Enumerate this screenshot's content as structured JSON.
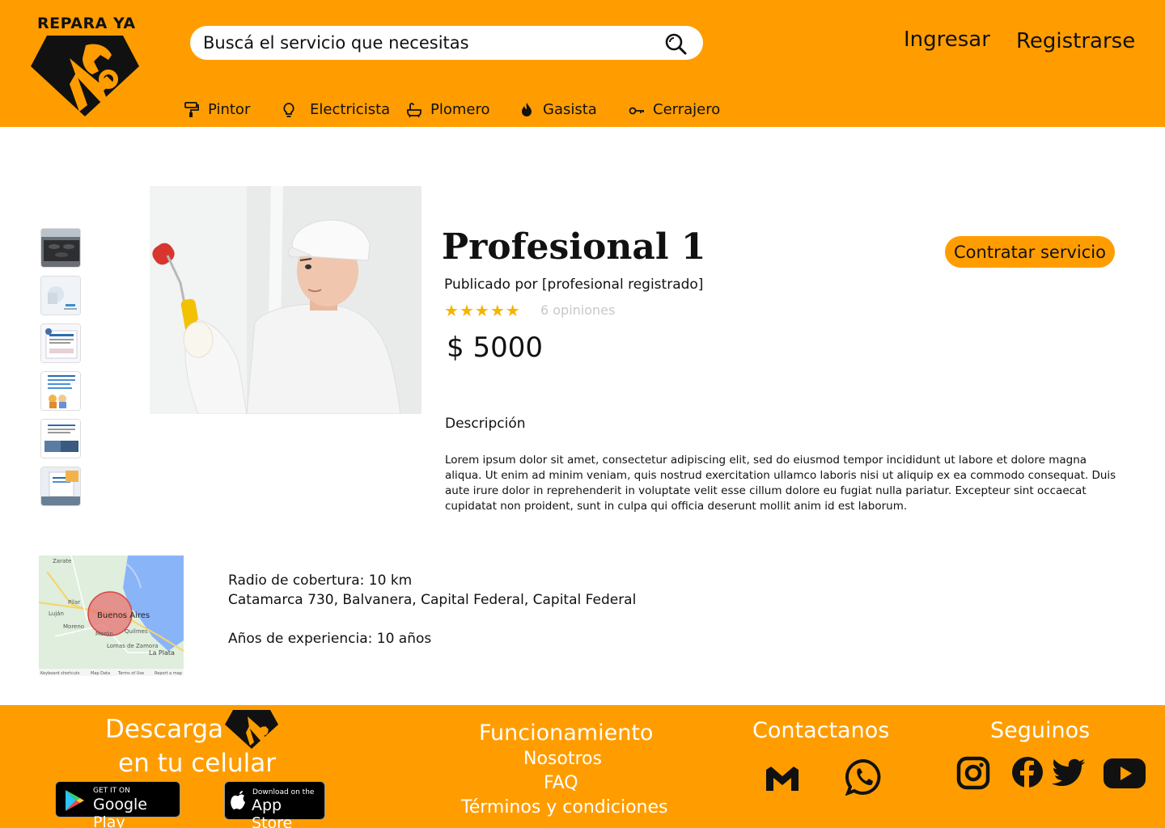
{
  "brand": {
    "name": "REPARA YA"
  },
  "header": {
    "search_placeholder": "Buscá el servicio que necesitas",
    "login": "Ingresar",
    "register": "Registrarse"
  },
  "nav": {
    "items": [
      {
        "label": "Pintor",
        "icon": "paint-roller-icon"
      },
      {
        "label": "Electricista",
        "icon": "lightbulb-icon"
      },
      {
        "label": "Plomero",
        "icon": "bathtub-icon"
      },
      {
        "label": "Gasista",
        "icon": "flame-icon"
      },
      {
        "label": "Cerrajero",
        "icon": "key-icon"
      }
    ]
  },
  "product": {
    "title": "Profesional 1",
    "published_by": "Publicado por [profesional registrado]",
    "rating": 5,
    "reviews": "6 opiniones",
    "price": "$ 5000",
    "hire_button": "Contratar servicio",
    "description_title": "Descripción",
    "description": "Lorem ipsum dolor sit amet, consectetur adipiscing elit, sed do eiusmod tempor incididunt ut labore et dolore magna aliqua. Ut enim ad minim veniam, quis nostrud exercitation ullamco laboris nisi ut aliquip ex ea commodo consequat. Duis aute irure dolor in reprehenderit in voluptate velit esse cillum dolore eu fugiat nulla pariatur. Excepteur sint occaecat cupidatat non proident, sunt in culpa qui officia deserunt mollit anim id est laborum."
  },
  "map": {
    "labels": [
      "Zarate",
      "Pilar",
      "Luján",
      "Moreno",
      "Morón",
      "Buenos Aires",
      "Quilmes",
      "Lomas de Zamora",
      "La Plata"
    ],
    "footer_labels": [
      "Keyboard shortcuts",
      "Map Data",
      "Terms of Use",
      "Report a map"
    ]
  },
  "details": {
    "coverage": "Radio de cobertura: 10 km",
    "address": "Catamarca 730, Balvanera, Capital Federal, Capital Federal",
    "experience": "Años de experiencia: 10 años"
  },
  "footer": {
    "download_line1": "Descarga",
    "download_line2": "en tu celular",
    "google_play_small": "GET IT ON",
    "google_play_big": "Google Play",
    "app_store_small": "Download on the",
    "app_store_big": "App Store",
    "how_it_works": "Funcionamiento",
    "links": [
      "Nosotros",
      "FAQ",
      "Términos y condiciones"
    ],
    "contact_title": "Contactanos",
    "follow_title": "Seguinos"
  },
  "colors": {
    "brand_orange": "#FF9D00",
    "star": "#F5B400",
    "text": "#111111",
    "footer_text": "#FFFFFF"
  }
}
